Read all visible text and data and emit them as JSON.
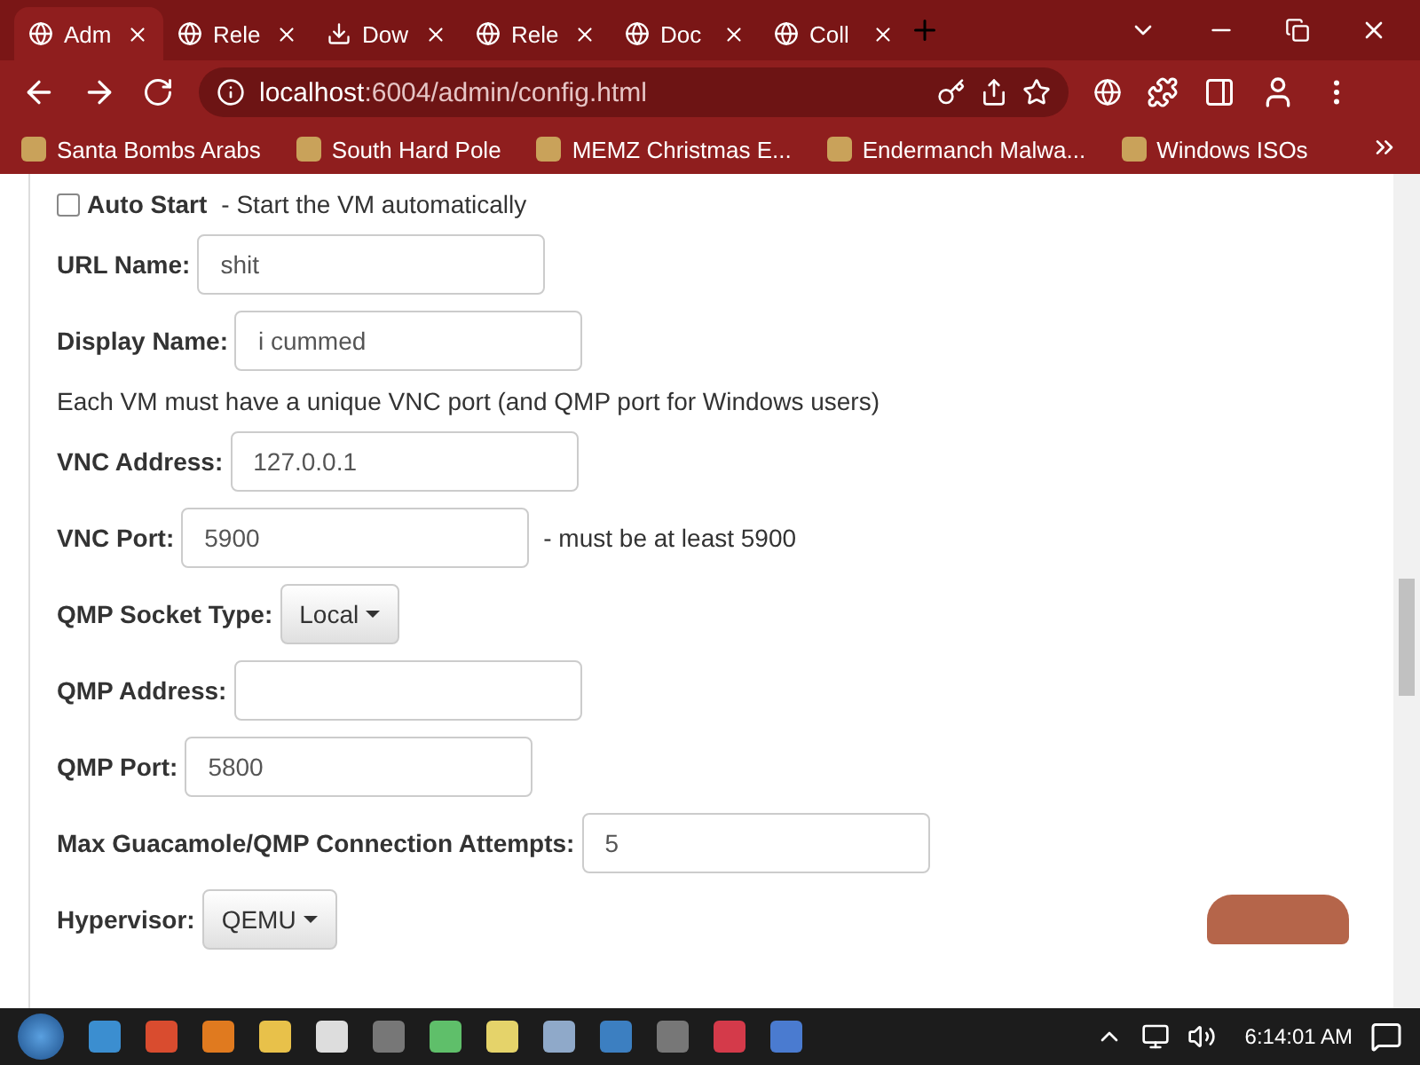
{
  "tabs": [
    {
      "label": "Adm",
      "selected": true
    },
    {
      "label": "Rele",
      "selected": false
    },
    {
      "label": "Dow",
      "selected": false
    },
    {
      "label": "Rele",
      "selected": false
    },
    {
      "label": "Doc",
      "selected": false
    },
    {
      "label": "Coll",
      "selected": false
    }
  ],
  "address_bar": {
    "host": "localhost",
    "path": ":6004/admin/config.html"
  },
  "bookmarks": [
    "Santa Bombs Arabs",
    "South Hard Pole",
    "MEMZ Christmas E...",
    "Endermanch Malwa...",
    "Windows ISOs"
  ],
  "form": [
    {
      "kind": "checkbox",
      "label": "Auto Start",
      "hint": "- Start the VM automatically",
      "checked": false
    },
    {
      "kind": "field",
      "label": "URL Name:",
      "value": "shit"
    },
    {
      "kind": "field",
      "label": "Display Name:",
      "value": "i cummed"
    },
    {
      "kind": "note",
      "text": "Each VM must have a unique VNC port (and QMP port for Windows users)"
    },
    {
      "kind": "field",
      "label": "VNC Address:",
      "value": "127.0.0.1"
    },
    {
      "kind": "field",
      "label": "VNC Port:",
      "value": "5900",
      "hint": "- must be at least 5900"
    },
    {
      "kind": "dropdown",
      "label": "QMP Socket Type:",
      "value": "Local"
    },
    {
      "kind": "field",
      "label": "QMP Address:"
    },
    {
      "kind": "field",
      "label": "QMP Port:",
      "value": "5800"
    },
    {
      "kind": "field",
      "label": "Max Guacamole/QMP Connection Attempts:",
      "value": "5"
    },
    {
      "kind": "dropdown",
      "label": "Hypervisor:",
      "value": "QEMU"
    }
  ],
  "taskbar": {
    "time": "6:14:01 AM"
  }
}
